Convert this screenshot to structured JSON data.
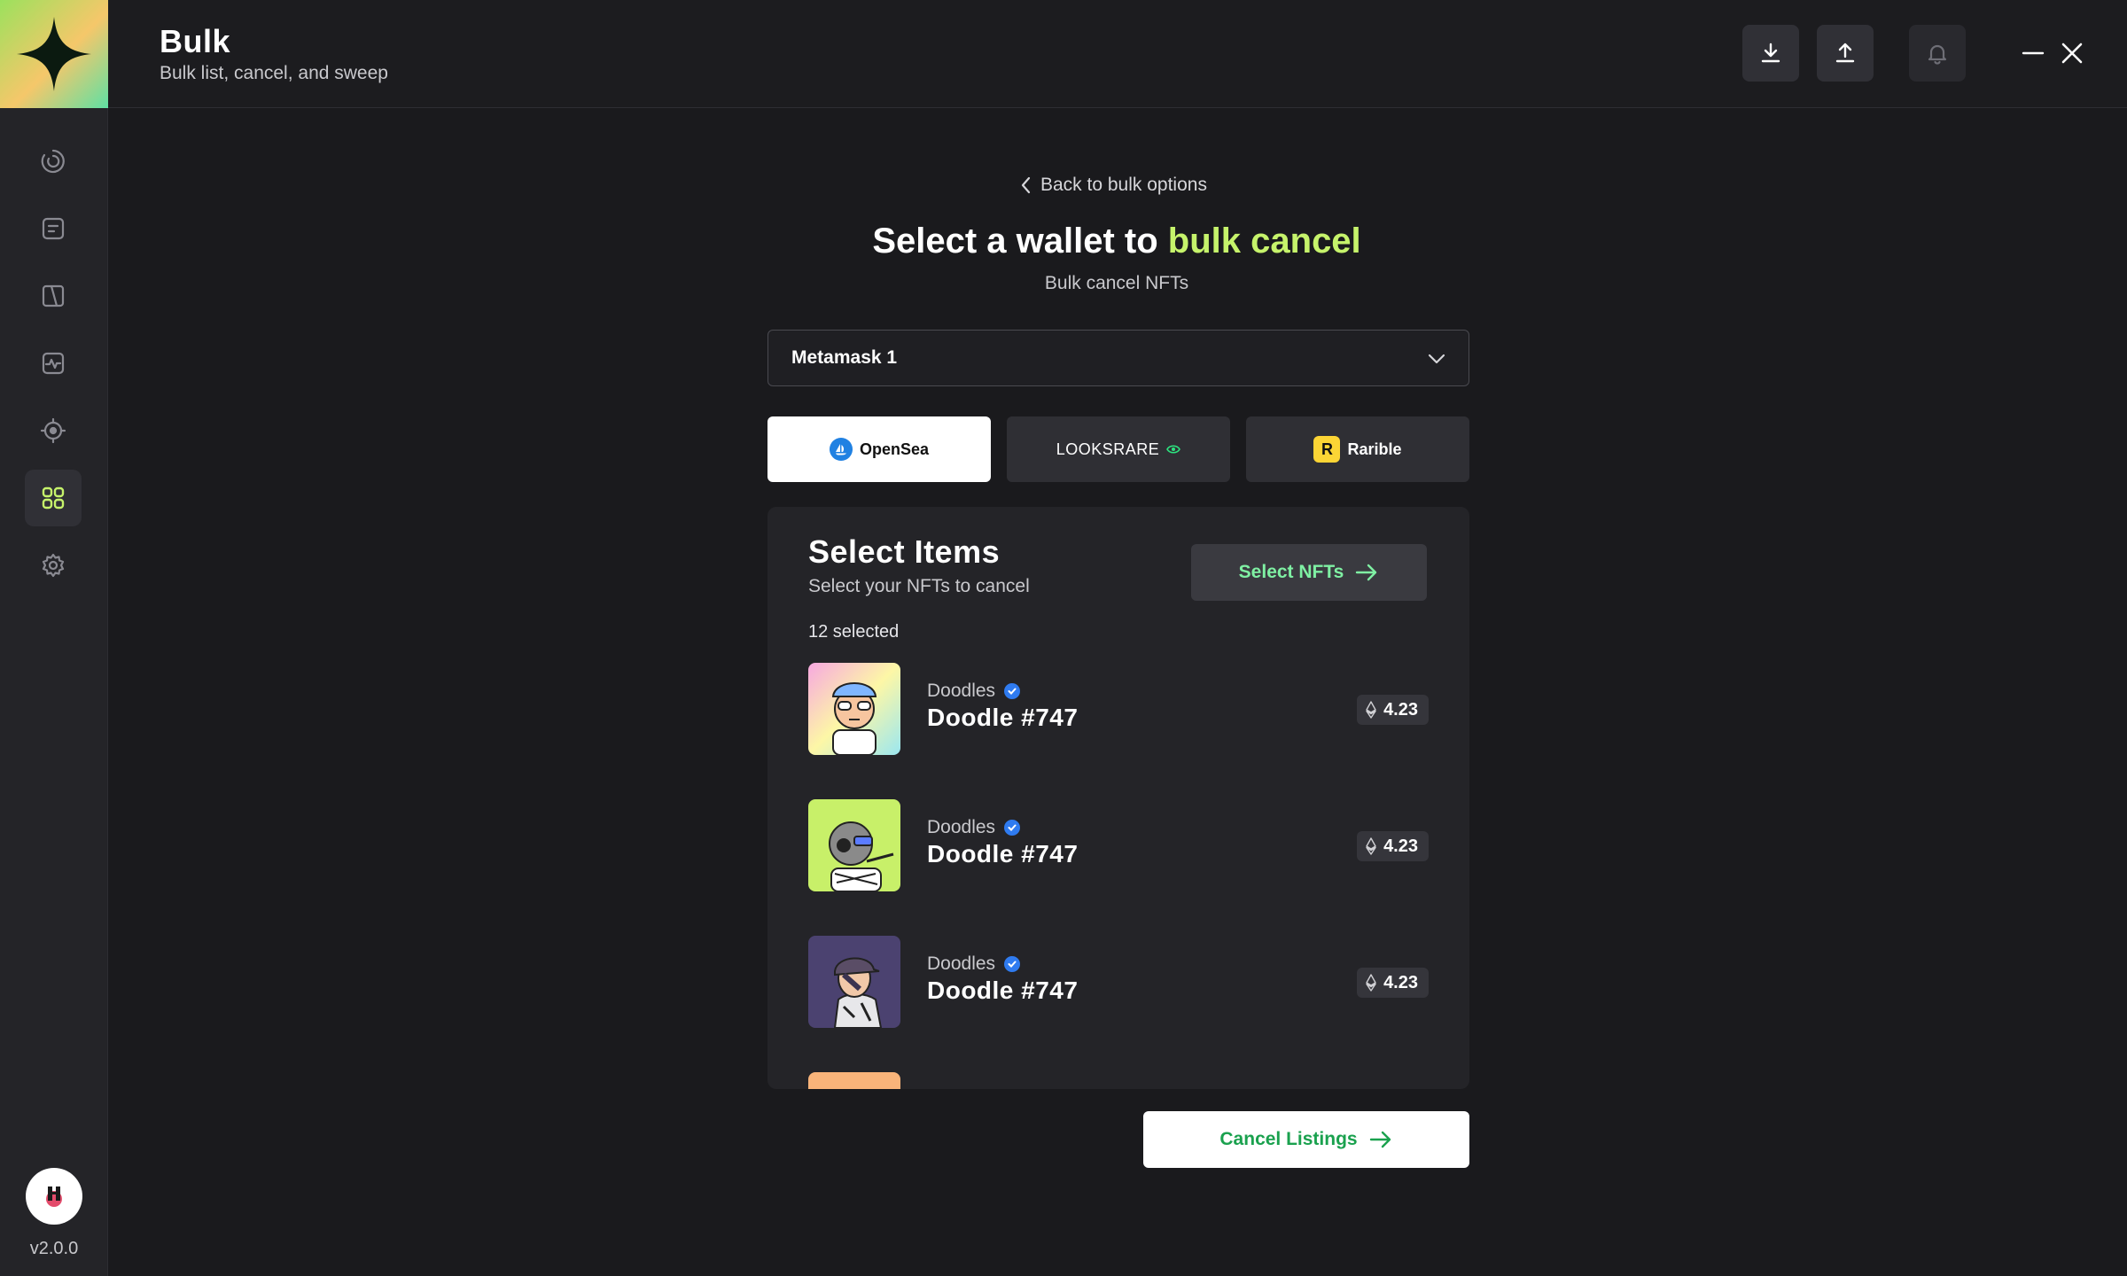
{
  "header": {
    "title": "Bulk",
    "subtitle": "Bulk list, cancel, and sweep",
    "icons": [
      "download-icon",
      "upload-icon",
      "bell-icon",
      "minimize-icon",
      "close-icon"
    ]
  },
  "sidebar": {
    "items": [
      {
        "icon": "loader-icon"
      },
      {
        "icon": "document-icon"
      },
      {
        "icon": "split-page-icon"
      },
      {
        "icon": "activity-icon"
      },
      {
        "icon": "target-icon"
      },
      {
        "icon": "grid-icon",
        "active": true
      },
      {
        "icon": "settings-icon"
      }
    ],
    "version": "v2.0.0"
  },
  "main": {
    "back_label": "Back to bulk options",
    "title_prefix": "Select a wallet to ",
    "title_accent": "bulk cancel",
    "subtitle": "Bulk cancel NFTs",
    "wallet": "Metamask 1",
    "marketplaces": [
      {
        "label": "OpenSea",
        "active": true
      },
      {
        "label": "LOOKSRARE",
        "active": false
      },
      {
        "label": "Rarible",
        "active": false
      }
    ]
  },
  "panel": {
    "title": "Select Items",
    "subtitle": "Select your NFTs to cancel",
    "select_button": "Select NFTs",
    "selected_count": "12 selected",
    "items": [
      {
        "collection": "Doodles",
        "name": "Doodle #747",
        "price": "4.23"
      },
      {
        "collection": "Doodles",
        "name": "Doodle #747",
        "price": "4.23"
      },
      {
        "collection": "Doodles",
        "name": "Doodle #747",
        "price": "4.23"
      }
    ]
  },
  "footer": {
    "cancel_button": "Cancel Listings"
  },
  "colors": {
    "accent": "#c6f36b",
    "green_text": "#7ff0a3",
    "cancel_text": "#1aa14e",
    "background": "#1a1a1d"
  }
}
